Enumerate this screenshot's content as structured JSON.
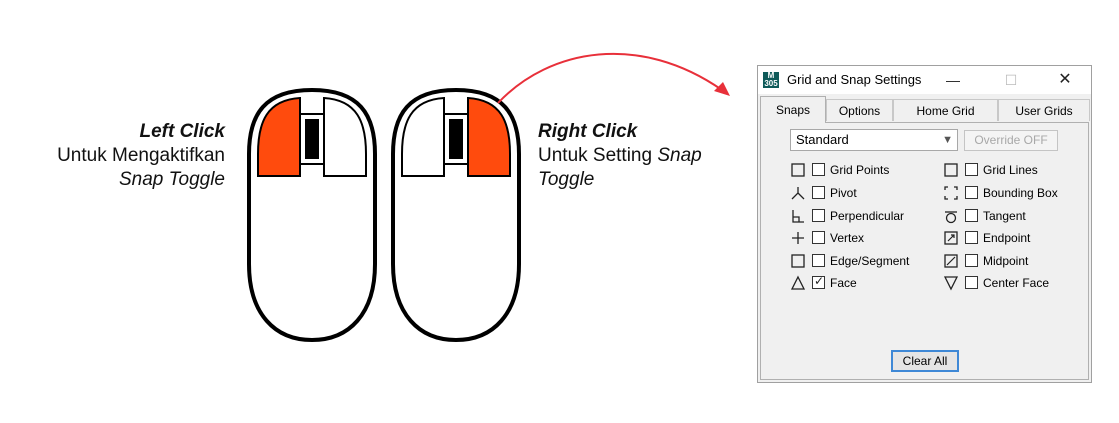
{
  "left_caption": {
    "title": "Left Click",
    "line1": "Untuk Mengaktifkan",
    "line2": "Snap Toggle"
  },
  "right_caption": {
    "title": "Right Click",
    "line1": "Untuk Setting ",
    "line1_italic": "Snap",
    "line2": "Toggle"
  },
  "colors": {
    "highlight": "#ff4b0d",
    "arrow": "#e8303a",
    "focus": "#3e88d6"
  },
  "dialog": {
    "icon_text": "M 305",
    "title": "Grid and Snap Settings",
    "controls": {
      "minimize": "—",
      "maximize": "☐",
      "close": "✕"
    },
    "tabs": [
      "Snaps",
      "Options",
      "Home Grid",
      "User Grids"
    ],
    "active_tab": "Snaps",
    "preset": "Standard",
    "override_label": "Override OFF",
    "snaps_left": [
      {
        "label": "Grid Points",
        "icon": "grid-points-icon",
        "checked": false
      },
      {
        "label": "Pivot",
        "icon": "pivot-icon",
        "checked": false
      },
      {
        "label": "Perpendicular",
        "icon": "perpendicular-icon",
        "checked": false
      },
      {
        "label": "Vertex",
        "icon": "vertex-icon",
        "checked": false
      },
      {
        "label": "Edge/Segment",
        "icon": "edge-segment-icon",
        "checked": false
      },
      {
        "label": "Face",
        "icon": "face-icon",
        "checked": true
      }
    ],
    "snaps_right": [
      {
        "label": "Grid Lines",
        "icon": "grid-lines-icon",
        "checked": false
      },
      {
        "label": "Bounding Box",
        "icon": "bounding-box-icon",
        "checked": false
      },
      {
        "label": "Tangent",
        "icon": "tangent-icon",
        "checked": false
      },
      {
        "label": "Endpoint",
        "icon": "endpoint-icon",
        "checked": false
      },
      {
        "label": "Midpoint",
        "icon": "midpoint-icon",
        "checked": false
      },
      {
        "label": "Center Face",
        "icon": "center-face-icon",
        "checked": false
      }
    ],
    "clear_all_label": "Clear All"
  }
}
